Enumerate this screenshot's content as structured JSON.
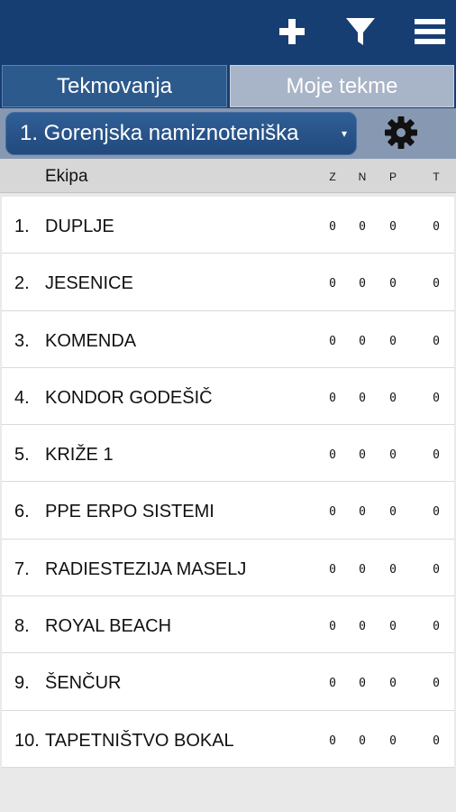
{
  "topbar": {
    "icons": [
      "plus-icon",
      "filter-icon",
      "menu-icon"
    ],
    "background": "#173e73"
  },
  "tabs": [
    {
      "label": "Tekmovanja",
      "active": true
    },
    {
      "label": "Moje tekme",
      "active": false
    }
  ],
  "selector": {
    "value": "1. Gorenjska namiznoteniška",
    "arrow": "▾"
  },
  "table": {
    "headers": {
      "team": "Ekipa",
      "z": "Z",
      "n": "N",
      "p": "P",
      "t": "T"
    },
    "rows": [
      {
        "rank": "1.",
        "name": "DUPLJE",
        "z": "0",
        "n": "0",
        "p": "0",
        "t": "0"
      },
      {
        "rank": "2.",
        "name": "JESENICE",
        "z": "0",
        "n": "0",
        "p": "0",
        "t": "0"
      },
      {
        "rank": "3.",
        "name": "KOMENDA",
        "z": "0",
        "n": "0",
        "p": "0",
        "t": "0"
      },
      {
        "rank": "4.",
        "name": "KONDOR GODEŠIČ",
        "z": "0",
        "n": "0",
        "p": "0",
        "t": "0"
      },
      {
        "rank": "5.",
        "name": "KRIŽE 1",
        "z": "0",
        "n": "0",
        "p": "0",
        "t": "0"
      },
      {
        "rank": "6.",
        "name": "PPE ERPO SISTEMI",
        "z": "0",
        "n": "0",
        "p": "0",
        "t": "0"
      },
      {
        "rank": "7.",
        "name": "RADIESTEZIJA MASELJ",
        "z": "0",
        "n": "0",
        "p": "0",
        "t": "0"
      },
      {
        "rank": "8.",
        "name": "ROYAL BEACH",
        "z": "0",
        "n": "0",
        "p": "0",
        "t": "0"
      },
      {
        "rank": "9.",
        "name": "ŠENČUR",
        "z": "0",
        "n": "0",
        "p": "0",
        "t": "0"
      },
      {
        "rank": "10.",
        "name": "TAPETNIŠTVO BOKAL",
        "z": "0",
        "n": "0",
        "p": "0",
        "t": "0"
      }
    ]
  }
}
